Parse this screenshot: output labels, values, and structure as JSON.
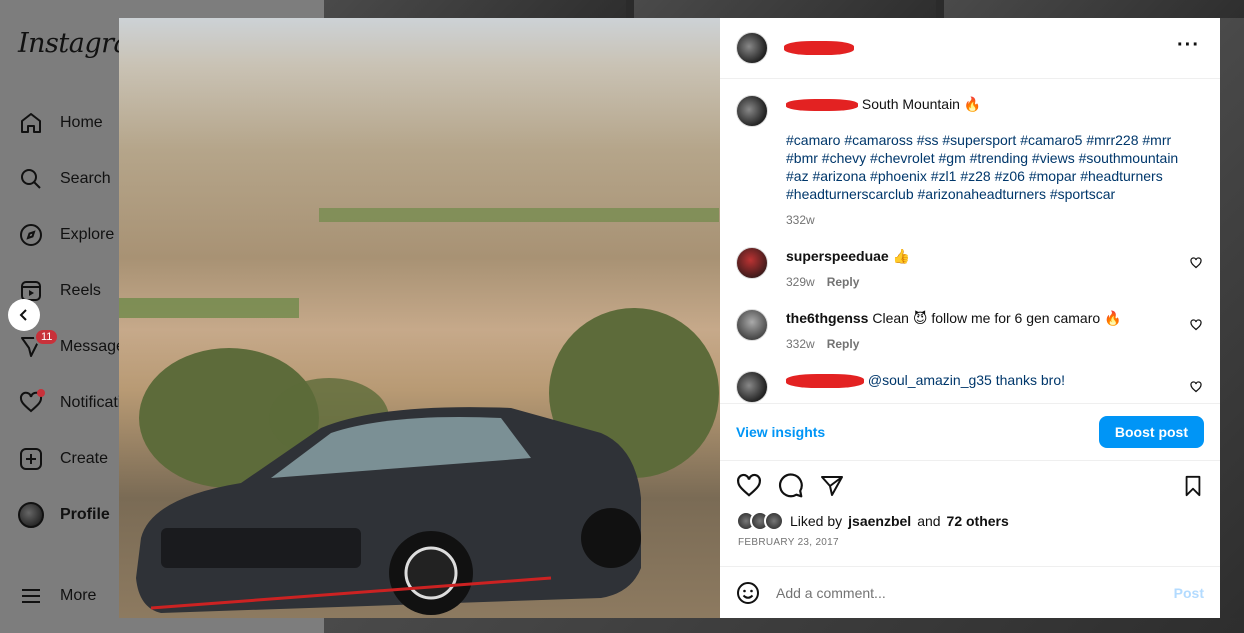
{
  "app": {
    "logo": "Instagram"
  },
  "sidebar": {
    "items": [
      {
        "label": "Home",
        "icon": "home-icon"
      },
      {
        "label": "Search",
        "icon": "search-icon"
      },
      {
        "label": "Explore",
        "icon": "compass-icon"
      },
      {
        "label": "Reels",
        "icon": "reels-icon"
      },
      {
        "label": "Messages",
        "icon": "messenger-icon",
        "badge": "11"
      },
      {
        "label": "Notifications",
        "icon": "heart-icon"
      },
      {
        "label": "Create",
        "icon": "plus-square-icon"
      },
      {
        "label": "Profile",
        "icon": "avatar"
      },
      {
        "label": "More",
        "icon": "menu-icon"
      }
    ]
  },
  "post": {
    "caption": {
      "text": "South Mountain 🔥",
      "hashtags": "#camaro #camaross #ss #supersport #camaro5 #mrr228 #mrr #bmr #chevy #chevrolet #gm #trending #views #southmountain #az #arizona #phoenix #zl1 #z28 #z06 #mopar #headturners #headturnerscarclub #arizonaheadturners #sportscar",
      "time": "332w"
    },
    "comments": [
      {
        "user": "superspeeduae",
        "text": "👍",
        "time": "329w",
        "reply": "Reply"
      },
      {
        "user": "the6thgenss",
        "text": "Clean 😈 follow me for 6 gen camaro 🔥",
        "time": "332w",
        "reply": "Reply"
      },
      {
        "user": "",
        "text": "@soul_amazin_g35 thanks bro!",
        "time": "",
        "reply": ""
      }
    ],
    "insights_label": "View insights",
    "boost_label": "Boost post",
    "likes": {
      "prefix": "Liked by",
      "user": "jsaenzbel",
      "and": "and",
      "others": "72 others"
    },
    "date": "FEBRUARY 23, 2017",
    "add_comment_placeholder": "Add a comment...",
    "post_label": "Post"
  },
  "colors": {
    "accent": "#0095f6",
    "redact": "#e32222",
    "badge": "#c8313a"
  }
}
